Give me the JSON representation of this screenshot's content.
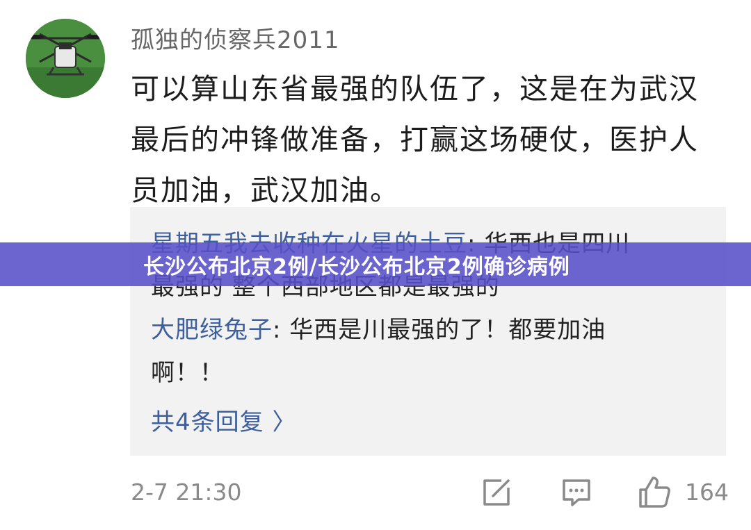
{
  "comment": {
    "username": "孤独的侦察兵2011",
    "text_lines": [
      "可以算山东省最强的队伍了，这是在为武汉",
      "最后的冲锋做准备，打赢这场硬仗，医护人",
      "员加油，武汉加油。"
    ],
    "timestamp": "2-7 21:30",
    "like_count": "164"
  },
  "replies": [
    {
      "author": "星期五我去收种在火星的土豆",
      "text_first": ": 华西也是四川",
      "text_second": "最强的  整个西部地区都是最强的"
    },
    {
      "author": "大肥绿兔子",
      "text_first": ": 华西是川最强的了！都要加油",
      "text_second": "啊！！"
    }
  ],
  "more_replies_label": "共4条回复 〉",
  "banner": {
    "title": "长沙公布北京2例/长沙公布北京2例确诊病例"
  },
  "colors": {
    "link_blue": "#3e5f9e",
    "banner_bg": "#5850c8",
    "reply_bg": "#f2f2f2",
    "meta_gray": "#8a8a8a"
  },
  "icons": {
    "avatar": "drone-avatar",
    "share": "share-edit-icon",
    "comment": "comment-icon",
    "like": "thumbs-up-icon"
  }
}
